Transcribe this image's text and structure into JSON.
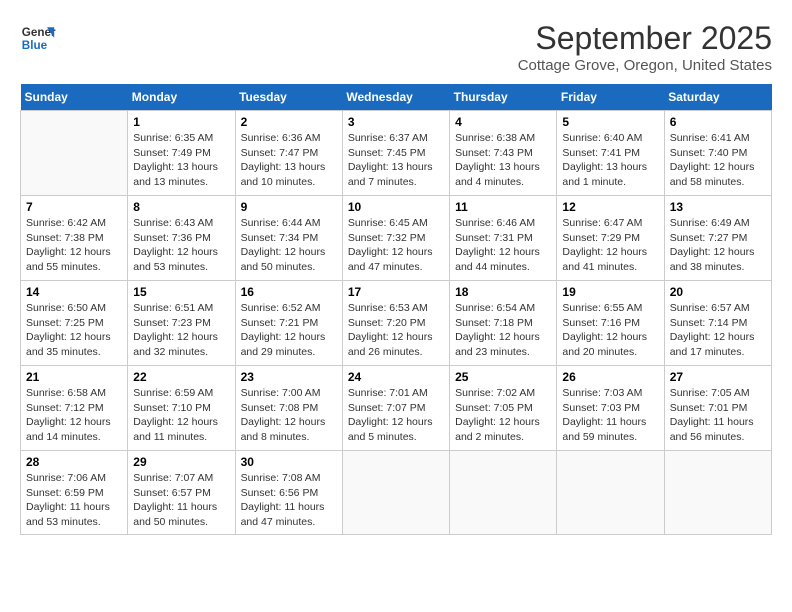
{
  "header": {
    "logo_line1": "General",
    "logo_line2": "Blue",
    "month_title": "September 2025",
    "subtitle": "Cottage Grove, Oregon, United States"
  },
  "days_of_week": [
    "Sunday",
    "Monday",
    "Tuesday",
    "Wednesday",
    "Thursday",
    "Friday",
    "Saturday"
  ],
  "weeks": [
    [
      {
        "day": "",
        "content": ""
      },
      {
        "day": "1",
        "content": "Sunrise: 6:35 AM\nSunset: 7:49 PM\nDaylight: 13 hours\nand 13 minutes."
      },
      {
        "day": "2",
        "content": "Sunrise: 6:36 AM\nSunset: 7:47 PM\nDaylight: 13 hours\nand 10 minutes."
      },
      {
        "day": "3",
        "content": "Sunrise: 6:37 AM\nSunset: 7:45 PM\nDaylight: 13 hours\nand 7 minutes."
      },
      {
        "day": "4",
        "content": "Sunrise: 6:38 AM\nSunset: 7:43 PM\nDaylight: 13 hours\nand 4 minutes."
      },
      {
        "day": "5",
        "content": "Sunrise: 6:40 AM\nSunset: 7:41 PM\nDaylight: 13 hours\nand 1 minute."
      },
      {
        "day": "6",
        "content": "Sunrise: 6:41 AM\nSunset: 7:40 PM\nDaylight: 12 hours\nand 58 minutes."
      }
    ],
    [
      {
        "day": "7",
        "content": "Sunrise: 6:42 AM\nSunset: 7:38 PM\nDaylight: 12 hours\nand 55 minutes."
      },
      {
        "day": "8",
        "content": "Sunrise: 6:43 AM\nSunset: 7:36 PM\nDaylight: 12 hours\nand 53 minutes."
      },
      {
        "day": "9",
        "content": "Sunrise: 6:44 AM\nSunset: 7:34 PM\nDaylight: 12 hours\nand 50 minutes."
      },
      {
        "day": "10",
        "content": "Sunrise: 6:45 AM\nSunset: 7:32 PM\nDaylight: 12 hours\nand 47 minutes."
      },
      {
        "day": "11",
        "content": "Sunrise: 6:46 AM\nSunset: 7:31 PM\nDaylight: 12 hours\nand 44 minutes."
      },
      {
        "day": "12",
        "content": "Sunrise: 6:47 AM\nSunset: 7:29 PM\nDaylight: 12 hours\nand 41 minutes."
      },
      {
        "day": "13",
        "content": "Sunrise: 6:49 AM\nSunset: 7:27 PM\nDaylight: 12 hours\nand 38 minutes."
      }
    ],
    [
      {
        "day": "14",
        "content": "Sunrise: 6:50 AM\nSunset: 7:25 PM\nDaylight: 12 hours\nand 35 minutes."
      },
      {
        "day": "15",
        "content": "Sunrise: 6:51 AM\nSunset: 7:23 PM\nDaylight: 12 hours\nand 32 minutes."
      },
      {
        "day": "16",
        "content": "Sunrise: 6:52 AM\nSunset: 7:21 PM\nDaylight: 12 hours\nand 29 minutes."
      },
      {
        "day": "17",
        "content": "Sunrise: 6:53 AM\nSunset: 7:20 PM\nDaylight: 12 hours\nand 26 minutes."
      },
      {
        "day": "18",
        "content": "Sunrise: 6:54 AM\nSunset: 7:18 PM\nDaylight: 12 hours\nand 23 minutes."
      },
      {
        "day": "19",
        "content": "Sunrise: 6:55 AM\nSunset: 7:16 PM\nDaylight: 12 hours\nand 20 minutes."
      },
      {
        "day": "20",
        "content": "Sunrise: 6:57 AM\nSunset: 7:14 PM\nDaylight: 12 hours\nand 17 minutes."
      }
    ],
    [
      {
        "day": "21",
        "content": "Sunrise: 6:58 AM\nSunset: 7:12 PM\nDaylight: 12 hours\nand 14 minutes."
      },
      {
        "day": "22",
        "content": "Sunrise: 6:59 AM\nSunset: 7:10 PM\nDaylight: 12 hours\nand 11 minutes."
      },
      {
        "day": "23",
        "content": "Sunrise: 7:00 AM\nSunset: 7:08 PM\nDaylight: 12 hours\nand 8 minutes."
      },
      {
        "day": "24",
        "content": "Sunrise: 7:01 AM\nSunset: 7:07 PM\nDaylight: 12 hours\nand 5 minutes."
      },
      {
        "day": "25",
        "content": "Sunrise: 7:02 AM\nSunset: 7:05 PM\nDaylight: 12 hours\nand 2 minutes."
      },
      {
        "day": "26",
        "content": "Sunrise: 7:03 AM\nSunset: 7:03 PM\nDaylight: 11 hours\nand 59 minutes."
      },
      {
        "day": "27",
        "content": "Sunrise: 7:05 AM\nSunset: 7:01 PM\nDaylight: 11 hours\nand 56 minutes."
      }
    ],
    [
      {
        "day": "28",
        "content": "Sunrise: 7:06 AM\nSunset: 6:59 PM\nDaylight: 11 hours\nand 53 minutes."
      },
      {
        "day": "29",
        "content": "Sunrise: 7:07 AM\nSunset: 6:57 PM\nDaylight: 11 hours\nand 50 minutes."
      },
      {
        "day": "30",
        "content": "Sunrise: 7:08 AM\nSunset: 6:56 PM\nDaylight: 11 hours\nand 47 minutes."
      },
      {
        "day": "",
        "content": ""
      },
      {
        "day": "",
        "content": ""
      },
      {
        "day": "",
        "content": ""
      },
      {
        "day": "",
        "content": ""
      }
    ]
  ]
}
